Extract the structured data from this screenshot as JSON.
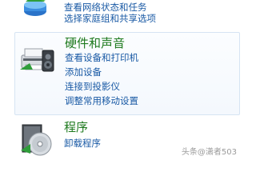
{
  "network": {
    "links": [
      "查看网络状态和任务",
      "选择家庭组和共享选项"
    ]
  },
  "hardware": {
    "title": "硬件和声音",
    "links": [
      "查看设备和打印机",
      "添加设备",
      "连接到投影仪",
      "调整常用移动设置"
    ]
  },
  "programs": {
    "title": "程序",
    "links": [
      "卸载程序"
    ]
  },
  "watermark": "头条@潇者503",
  "colors": {
    "link": "#1a5aa5",
    "category_title": "#1e7a1e",
    "highlight_border": "#d6e4f3"
  },
  "icons": {
    "network": "network-globe-icon",
    "hardware": "printer-speaker-icon",
    "programs": "programs-disc-box-icon"
  }
}
